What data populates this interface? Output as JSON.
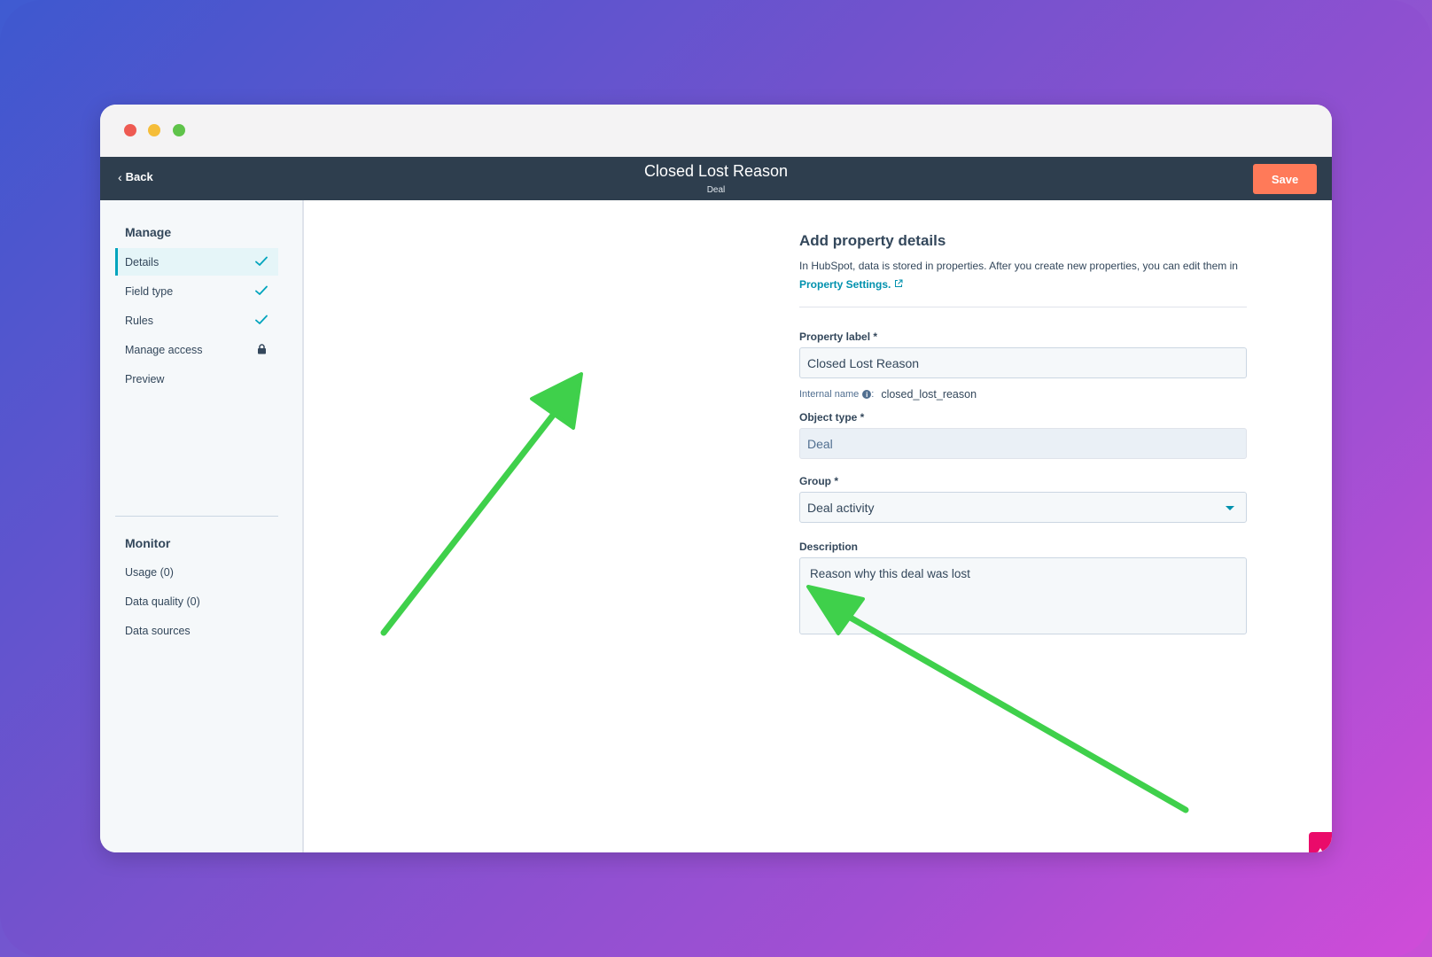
{
  "window": {
    "controls": [
      "close",
      "minimize",
      "zoom"
    ]
  },
  "topnav": {
    "back_label": "Back",
    "title": "Closed Lost Reason",
    "subtitle": "Deal",
    "save_label": "Save"
  },
  "sidebar": {
    "manage_heading": "Manage",
    "manage_items": [
      {
        "label": "Details",
        "icon": "check-icon",
        "active": true
      },
      {
        "label": "Field type",
        "icon": "check-icon"
      },
      {
        "label": "Rules",
        "icon": "check-icon"
      },
      {
        "label": "Manage access",
        "icon": "lock-icon"
      },
      {
        "label": "Preview"
      }
    ],
    "monitor_heading": "Monitor",
    "monitor_items": [
      {
        "label": "Usage (0)"
      },
      {
        "label": "Data quality (0)"
      },
      {
        "label": "Data sources"
      }
    ]
  },
  "form": {
    "heading": "Add property details",
    "intro_text": "In HubSpot, data is stored in properties. After you create new properties, you can edit them in",
    "intro_link": "Property Settings.",
    "property_label": {
      "label": "Property label *",
      "value": "Closed Lost Reason"
    },
    "internal_name": {
      "label": "Internal name",
      "value": "closed_lost_reason"
    },
    "object_type": {
      "label": "Object type *",
      "value": "Deal"
    },
    "group": {
      "label": "Group *",
      "value": "Deal activity"
    },
    "description": {
      "label": "Description",
      "value": "Reason why this deal was lost"
    }
  },
  "colors": {
    "nav_bg": "#2e3e4e",
    "save_bg": "#ff7a59",
    "accent": "#00a4bd",
    "arrow": "#3fd04b",
    "feedback": "#ea0b6a"
  }
}
